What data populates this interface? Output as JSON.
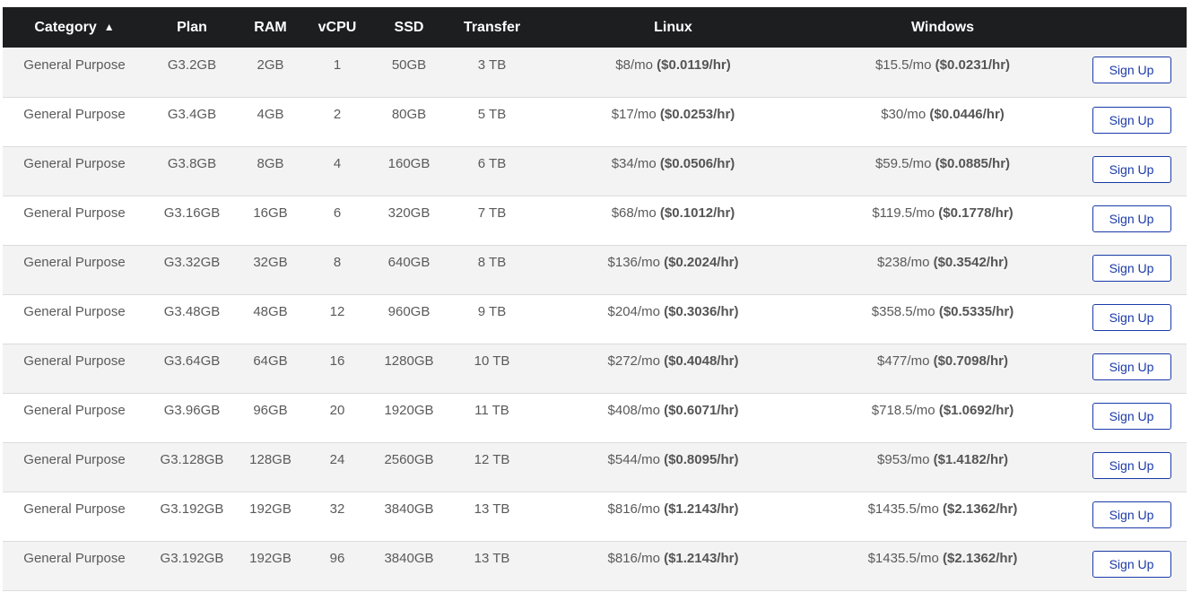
{
  "columns": {
    "category": "Category",
    "plan": "Plan",
    "ram": "RAM",
    "vcpu": "vCPU",
    "ssd": "SSD",
    "transfer": "Transfer",
    "linux": "Linux",
    "windows": "Windows",
    "sort_indicator": "▲"
  },
  "button_label": "Sign Up",
  "rows": [
    {
      "category": "General Purpose",
      "plan": "G3.2GB",
      "ram": "2GB",
      "vcpu": "1",
      "ssd": "50GB",
      "transfer": "3 TB",
      "linux_mo": "$8/mo",
      "linux_hr": "($0.0119/hr)",
      "win_mo": "$15.5/mo",
      "win_hr": "($0.0231/hr)"
    },
    {
      "category": "General Purpose",
      "plan": "G3.4GB",
      "ram": "4GB",
      "vcpu": "2",
      "ssd": "80GB",
      "transfer": "5 TB",
      "linux_mo": "$17/mo",
      "linux_hr": "($0.0253/hr)",
      "win_mo": "$30/mo",
      "win_hr": "($0.0446/hr)"
    },
    {
      "category": "General Purpose",
      "plan": "G3.8GB",
      "ram": "8GB",
      "vcpu": "4",
      "ssd": "160GB",
      "transfer": "6 TB",
      "linux_mo": "$34/mo",
      "linux_hr": "($0.0506/hr)",
      "win_mo": "$59.5/mo",
      "win_hr": "($0.0885/hr)"
    },
    {
      "category": "General Purpose",
      "plan": "G3.16GB",
      "ram": "16GB",
      "vcpu": "6",
      "ssd": "320GB",
      "transfer": "7 TB",
      "linux_mo": "$68/mo",
      "linux_hr": "($0.1012/hr)",
      "win_mo": "$119.5/mo",
      "win_hr": "($0.1778/hr)"
    },
    {
      "category": "General Purpose",
      "plan": "G3.32GB",
      "ram": "32GB",
      "vcpu": "8",
      "ssd": "640GB",
      "transfer": "8 TB",
      "linux_mo": "$136/mo",
      "linux_hr": "($0.2024/hr)",
      "win_mo": "$238/mo",
      "win_hr": "($0.3542/hr)"
    },
    {
      "category": "General Purpose",
      "plan": "G3.48GB",
      "ram": "48GB",
      "vcpu": "12",
      "ssd": "960GB",
      "transfer": "9 TB",
      "linux_mo": "$204/mo",
      "linux_hr": "($0.3036/hr)",
      "win_mo": "$358.5/mo",
      "win_hr": "($0.5335/hr)"
    },
    {
      "category": "General Purpose",
      "plan": "G3.64GB",
      "ram": "64GB",
      "vcpu": "16",
      "ssd": "1280GB",
      "transfer": "10 TB",
      "linux_mo": "$272/mo",
      "linux_hr": "($0.4048/hr)",
      "win_mo": "$477/mo",
      "win_hr": "($0.7098/hr)"
    },
    {
      "category": "General Purpose",
      "plan": "G3.96GB",
      "ram": "96GB",
      "vcpu": "20",
      "ssd": "1920GB",
      "transfer": "11 TB",
      "linux_mo": "$408/mo",
      "linux_hr": "($0.6071/hr)",
      "win_mo": "$718.5/mo",
      "win_hr": "($1.0692/hr)"
    },
    {
      "category": "General Purpose",
      "plan": "G3.128GB",
      "ram": "128GB",
      "vcpu": "24",
      "ssd": "2560GB",
      "transfer": "12 TB",
      "linux_mo": "$544/mo",
      "linux_hr": "($0.8095/hr)",
      "win_mo": "$953/mo",
      "win_hr": "($1.4182/hr)"
    },
    {
      "category": "General Purpose",
      "plan": "G3.192GB",
      "ram": "192GB",
      "vcpu": "32",
      "ssd": "3840GB",
      "transfer": "13 TB",
      "linux_mo": "$816/mo",
      "linux_hr": "($1.2143/hr)",
      "win_mo": "$1435.5/mo",
      "win_hr": "($2.1362/hr)"
    },
    {
      "category": "General Purpose",
      "plan": "G3.192GB",
      "ram": "192GB",
      "vcpu": "96",
      "ssd": "3840GB",
      "transfer": "13 TB",
      "linux_mo": "$816/mo",
      "linux_hr": "($1.2143/hr)",
      "win_mo": "$1435.5/mo",
      "win_hr": "($2.1362/hr)"
    }
  ]
}
